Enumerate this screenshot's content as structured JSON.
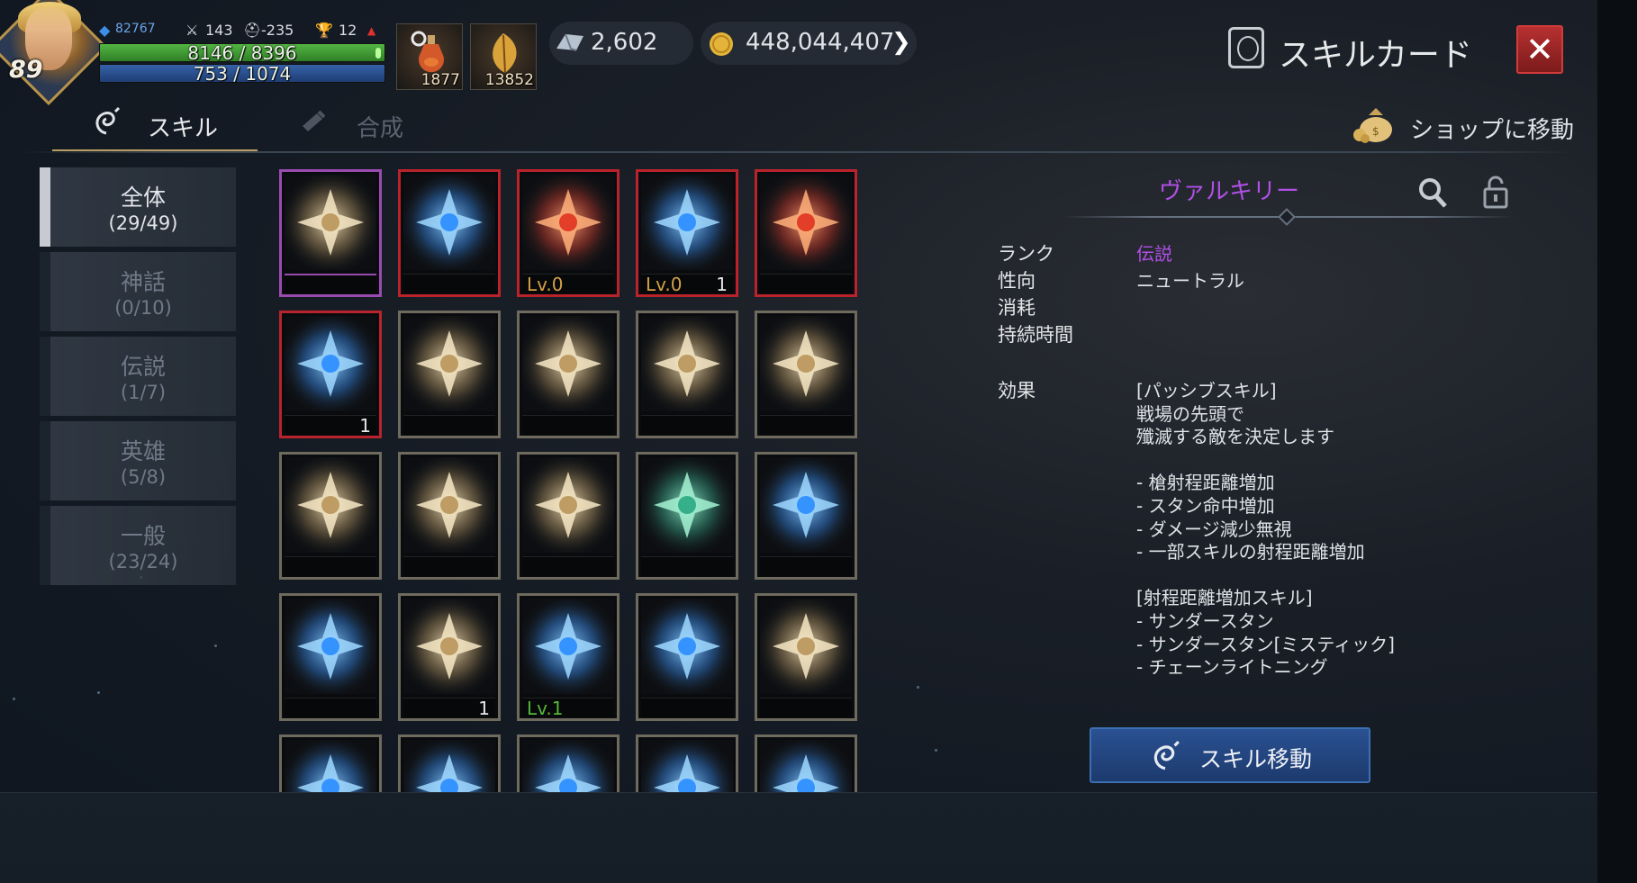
{
  "player": {
    "level": "89",
    "power": "82767",
    "attack": "143",
    "defense": "-235",
    "trophy": "12",
    "hp_text": "8146 / 8396",
    "hp_fraction": 0.97,
    "mp_text": "753 / 1074",
    "mp_fraction": 0.7
  },
  "potions": [
    {
      "name": "hp-potion",
      "count": "1877"
    },
    {
      "name": "leaf-item",
      "count": "13852"
    }
  ],
  "currency": {
    "crystal": "2,602",
    "gold": "448,044,407"
  },
  "window": {
    "title": "スキルカード",
    "close_icon": "close-icon"
  },
  "tabs": [
    {
      "label": "スキル",
      "active": true
    },
    {
      "label": "合成",
      "active": false
    }
  ],
  "shop": {
    "label": "ショップに移動"
  },
  "categories": [
    {
      "name": "全体",
      "count": "(29/49)",
      "active": true
    },
    {
      "name": "神話",
      "count": "(0/10)",
      "active": false
    },
    {
      "name": "伝説",
      "count": "(1/7)",
      "active": false
    },
    {
      "name": "英雄",
      "count": "(5/8)",
      "active": false
    },
    {
      "name": "一般",
      "count": "(23/24)",
      "active": false
    }
  ],
  "skills": [
    {
      "icon": "winged-sword-icon",
      "border": "purple",
      "level": "",
      "qty": ""
    },
    {
      "icon": "blue-wing-strike-icon",
      "border": "red",
      "level": "",
      "qty": ""
    },
    {
      "icon": "red-lightning-fist-icon",
      "border": "red",
      "level": "Lv.0",
      "qty": ""
    },
    {
      "icon": "blue-shield-warrior-icon",
      "border": "red",
      "level": "Lv.0",
      "qty": "1"
    },
    {
      "icon": "red-x-burst-icon",
      "border": "red",
      "level": "",
      "qty": ""
    },
    {
      "icon": "blue-electric-fist-icon",
      "border": "red",
      "level": "",
      "qty": "1"
    },
    {
      "icon": "shield-icon",
      "border": "gold",
      "level": "",
      "qty": ""
    },
    {
      "icon": "lightning-bolt-icon",
      "border": "gold",
      "level": "",
      "qty": ""
    },
    {
      "icon": "curved-arrow-icon",
      "border": "gold",
      "level": "",
      "qty": ""
    },
    {
      "icon": "starburst-icon",
      "border": "gold",
      "level": "",
      "qty": ""
    },
    {
      "icon": "weight-sparkle-icon",
      "border": "gold",
      "level": "",
      "qty": ""
    },
    {
      "icon": "eye-icon",
      "border": "gold",
      "level": "",
      "qty": ""
    },
    {
      "icon": "dragon-swirl-icon",
      "border": "gold",
      "level": "",
      "qty": ""
    },
    {
      "icon": "green-crossed-leaf-icon",
      "border": "gold",
      "level": "",
      "qty": ""
    },
    {
      "icon": "blue-bolt-icon",
      "border": "gold",
      "level": "",
      "qty": ""
    },
    {
      "icon": "chain-lightning-icon",
      "border": "gold",
      "level": "",
      "qty": ""
    },
    {
      "icon": "star-circle-icon",
      "border": "gold",
      "level": "",
      "qty": "1"
    },
    {
      "icon": "thunder-orb-icon",
      "border": "gold",
      "level": "Lv.1",
      "qty": ""
    },
    {
      "icon": "lightning-spear-icon",
      "border": "gold",
      "level": "",
      "qty": ""
    },
    {
      "icon": "spear-burst-icon",
      "border": "gold",
      "level": "",
      "qty": ""
    },
    {
      "icon": "blue-ice-warrior-icon",
      "border": "gold",
      "level": "",
      "qty": ""
    },
    {
      "icon": "blue-tree-lightning-icon",
      "border": "gold",
      "level": "",
      "qty": ""
    },
    {
      "icon": "blue-shield-icon",
      "border": "gold",
      "level": "",
      "qty": ""
    },
    {
      "icon": "blue-wave-icon",
      "border": "gold",
      "level": "",
      "qty": ""
    },
    {
      "icon": "blue-mask-icon",
      "border": "gold",
      "level": "",
      "qty": ""
    }
  ],
  "detail": {
    "name": "ヴァルキリー",
    "rank_label": "ランク",
    "rank_value": "伝説",
    "align_label": "性向",
    "align_value": "ニュートラル",
    "cost_label": "消耗",
    "duration_label": "持続時間",
    "effect_label": "効果",
    "effect_lines": [
      "[パッシブスキル]",
      "戦場の先頭で",
      "殲滅する敵を決定します",
      "",
      "-  槍射程距離増加",
      "-  スタン命中増加",
      "-  ダメージ減少無視",
      "-  一部スキルの射程距離増加",
      "",
      "[射程距離増加スキル]",
      "-  サンダースタン",
      "-  サンダースタン[ミスティック]",
      "-  チェーンライトニング"
    ],
    "move_button": "スキル移動"
  },
  "colors": {
    "rank_purple": "#b050e6",
    "red_border": "#b9232b",
    "gold_border": "#6f6a5e",
    "level_gold": "#d4a146",
    "level_green": "#56b63a",
    "button_blue": "#2a5192"
  }
}
